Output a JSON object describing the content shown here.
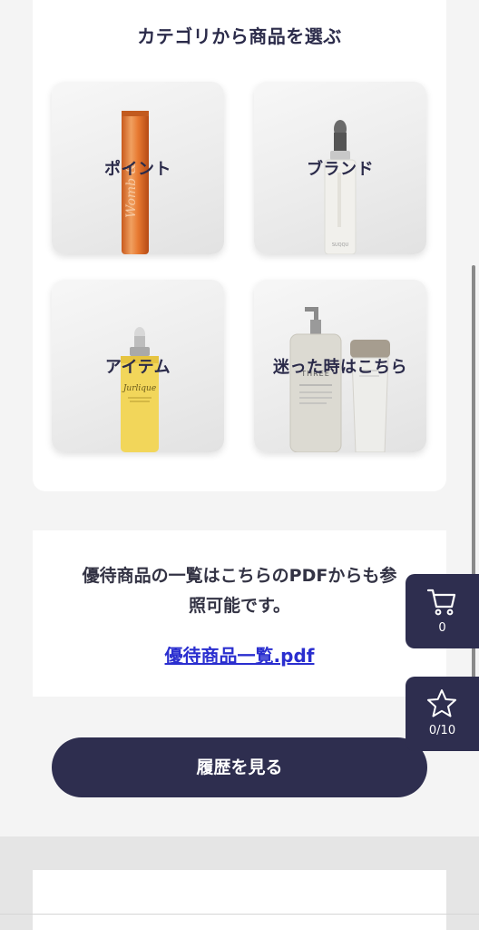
{
  "categories": {
    "title": "カテゴリから商品を選ぶ",
    "tiles": [
      {
        "label": "ポイント",
        "product": "orange-lip-stick"
      },
      {
        "label": "ブランド",
        "product": "dropper-serum-bottle"
      },
      {
        "label": "アイテム",
        "product": "yellow-face-oil-bottle"
      },
      {
        "label": "迷った時はこちら",
        "product": "pump-bottle-and-tube"
      }
    ],
    "product_brand_text": {
      "jurlique": "Jurlique",
      "three": "THREE"
    }
  },
  "pdf_notice": {
    "text_line1": "優待商品の一覧はこちらのPDFからも参",
    "text_line2": "照可能です。",
    "link_label": "優待商品一覧.pdf"
  },
  "history_button": {
    "label": "履歴を見る"
  },
  "floating": {
    "cart_icon": "cart-icon",
    "cart_count": "0",
    "favorite_icon": "star-icon",
    "favorite_count": "0/10"
  },
  "colors": {
    "navy": "#2e2e4f",
    "link_blue": "#2a2ecf",
    "page_bg": "#f4f4f4"
  }
}
